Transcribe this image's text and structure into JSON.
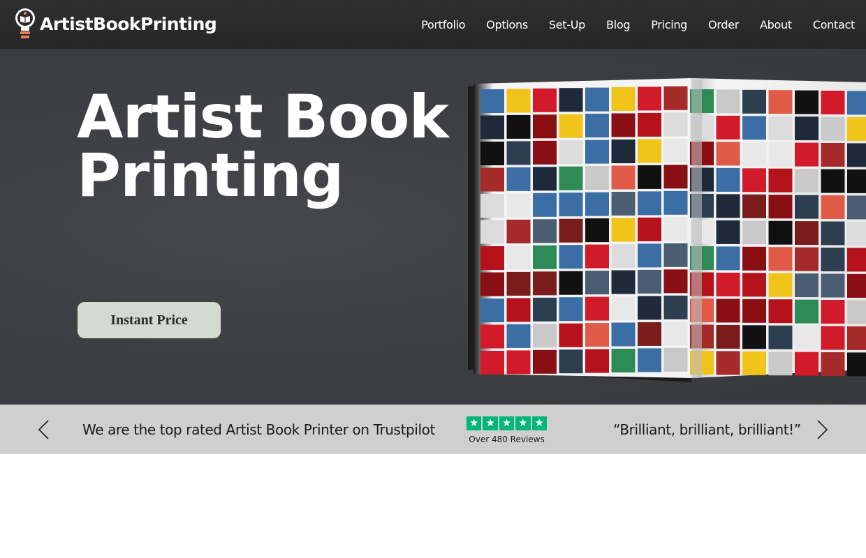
{
  "header": {
    "logo_text": "ArtistBookPrinting",
    "nav": [
      "Portfolio",
      "Options",
      "Set-Up",
      "Blog",
      "Pricing",
      "Order",
      "About",
      "Contact"
    ]
  },
  "hero": {
    "title_line1": "Artist Book",
    "title_line2": "Printing",
    "cta_label": "Instant Price"
  },
  "strip": {
    "tagline": "We are the top rated Artist Book Printer on Trustpilot",
    "trustpilot": {
      "stars": 5,
      "reviews": "Over 480 Reviews",
      "star_color": "#00b67a"
    },
    "quote": "“Brilliant, brilliant, brilliant!”"
  },
  "icons": {
    "logo": "lightbulb-book-icon",
    "prev": "chevron-left-icon",
    "next": "chevron-right-icon",
    "star": "star-icon"
  },
  "colors": {
    "header_bg": "#2b2b2b",
    "hero_bg": "#3d3f42",
    "cta_bg": "#d2dbd0",
    "strip_bg": "#cfcfcf",
    "logo_accent": "#e8805a"
  }
}
